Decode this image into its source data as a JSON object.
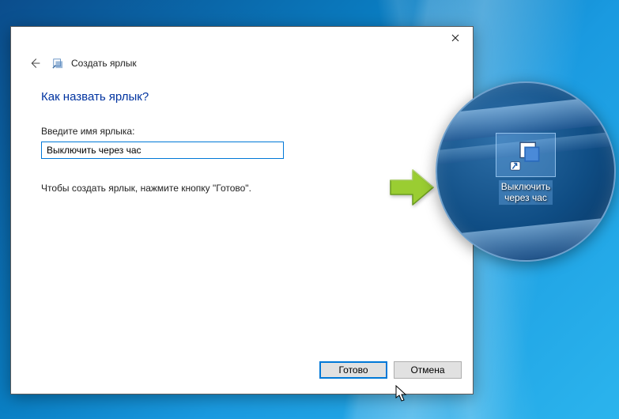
{
  "dialog": {
    "wizard_title": "Создать ярлык",
    "heading": "Как назвать ярлык?",
    "input_label": "Введите имя ярлыка:",
    "input_value": "Выключить через час",
    "instruction": "Чтобы создать ярлык, нажмите кнопку \"Готово\".",
    "buttons": {
      "finish": "Готово",
      "cancel": "Отмена"
    }
  },
  "desktop_shortcut": {
    "label": "Выключить\nчерез час"
  }
}
